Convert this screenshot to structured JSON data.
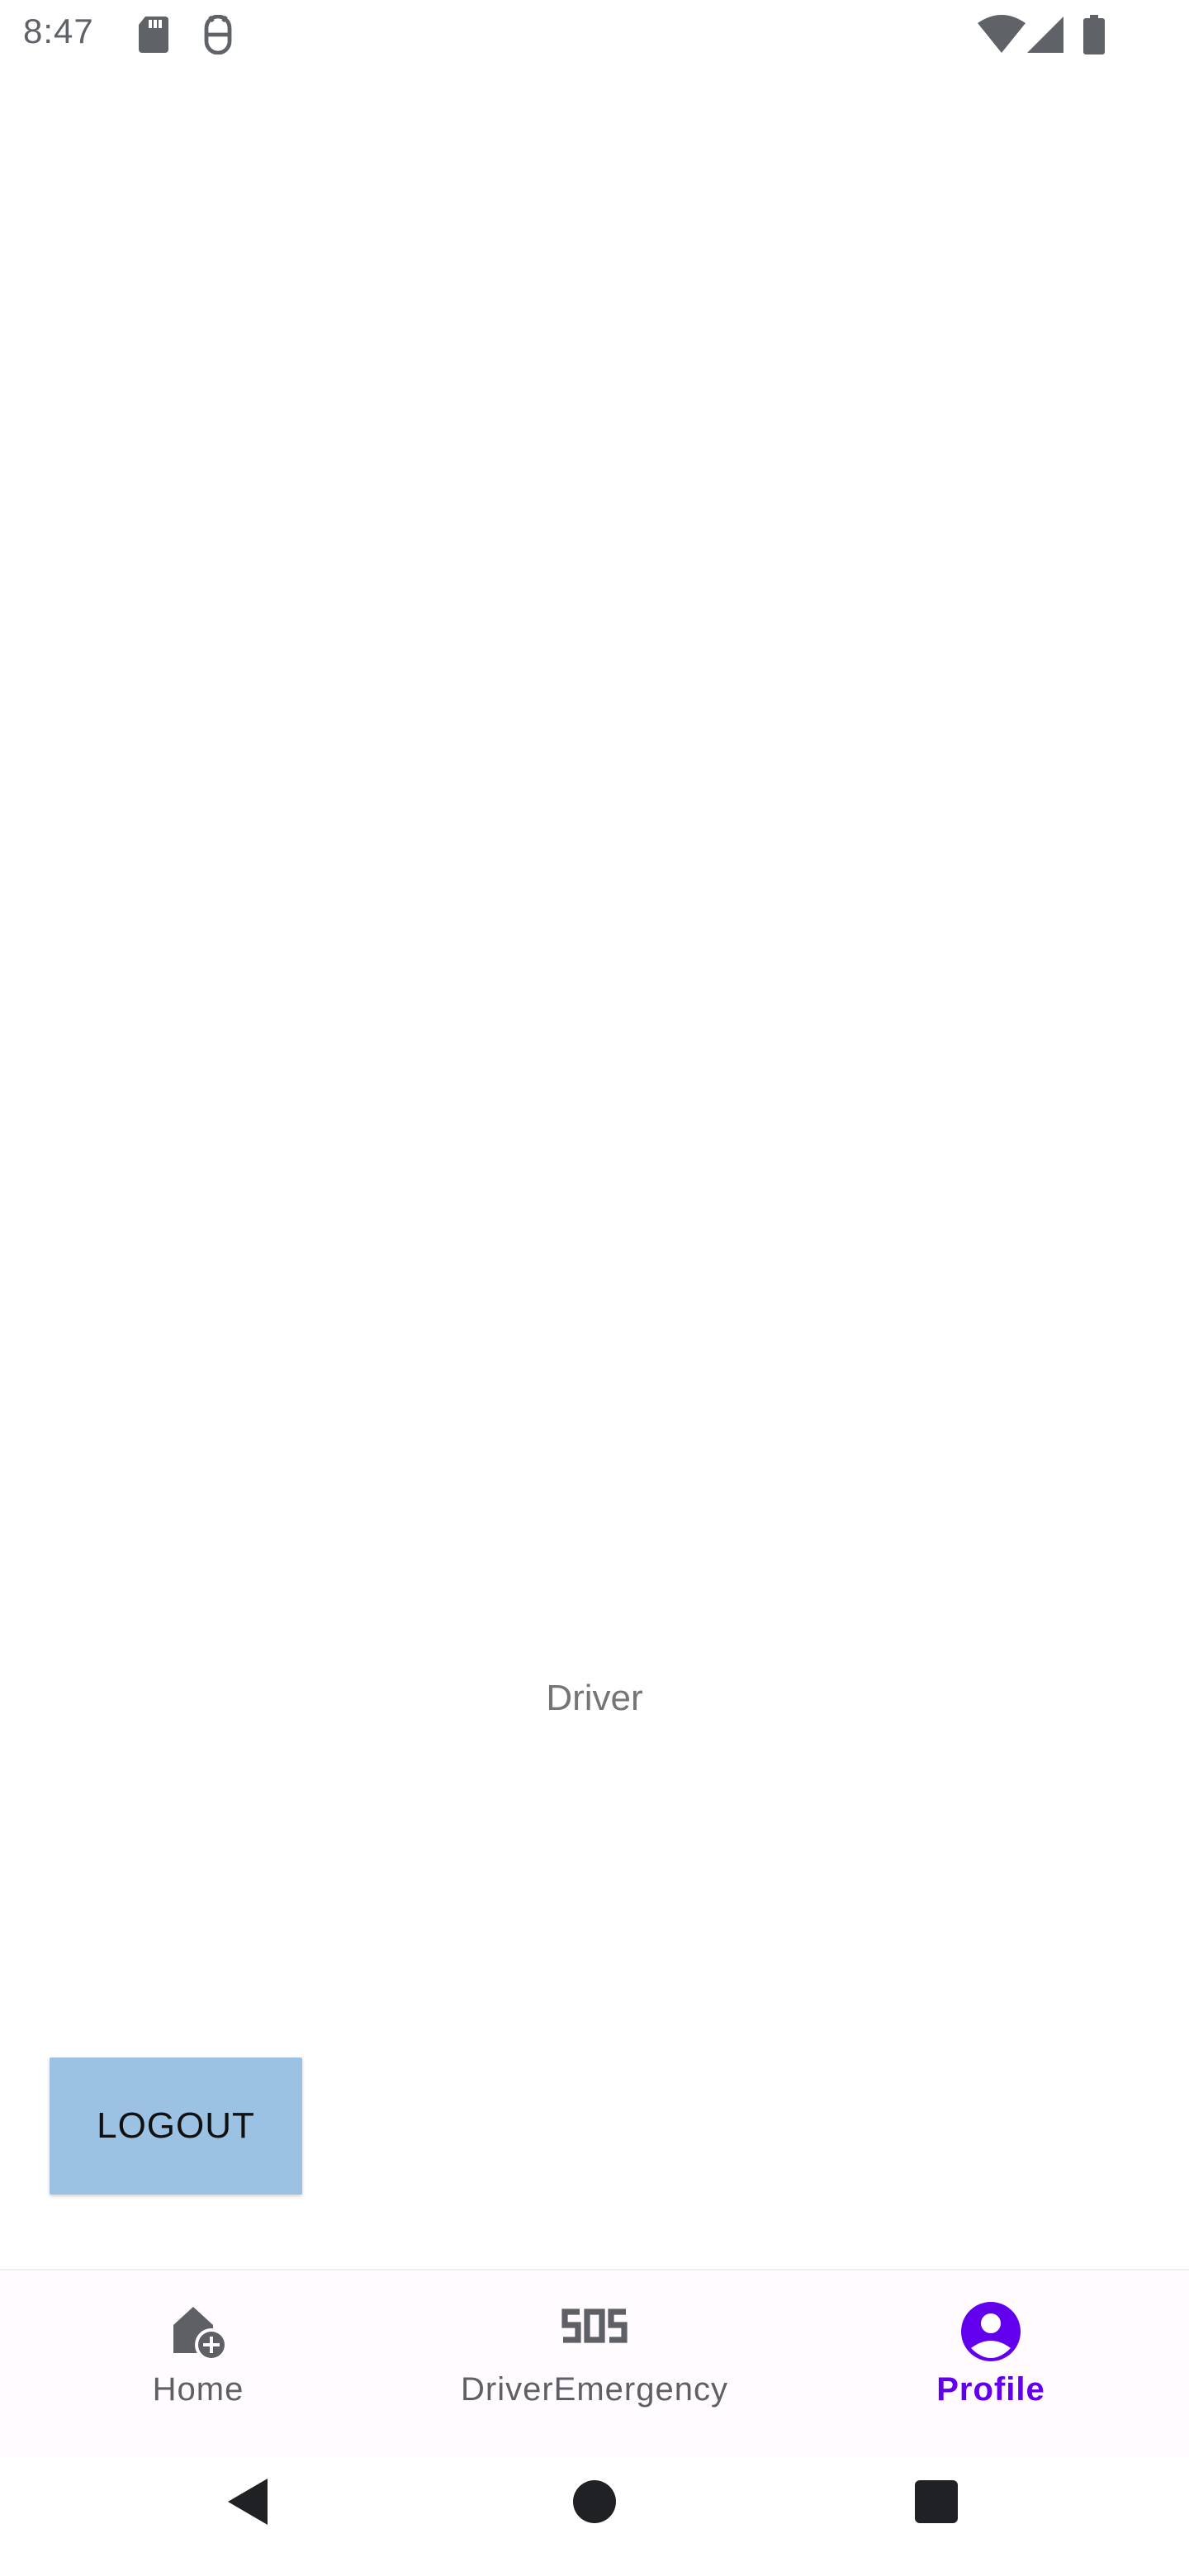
{
  "status_bar": {
    "time": "8:47",
    "icons": [
      "sd-card-icon",
      "android-debug-icon",
      "wifi-icon",
      "cell-signal-icon",
      "battery-icon"
    ]
  },
  "profile": {
    "role": "Driver",
    "logout_label": "LOGOUT"
  },
  "bottom_nav": {
    "items": [
      {
        "label": "Home",
        "icon": "home-add-icon",
        "active": false
      },
      {
        "label": "DriverEmergency",
        "icon": "sos-icon",
        "active": false
      },
      {
        "label": "Profile",
        "icon": "account-circle-icon",
        "active": true
      }
    ]
  },
  "system_nav": {
    "buttons": [
      "back-icon",
      "home-icon",
      "recents-icon"
    ]
  },
  "colors": {
    "accent": "#6200ee",
    "logout_button_bg": "#9bc1e3",
    "inactive_nav": "#5f5f66",
    "role_text": "#757575"
  }
}
